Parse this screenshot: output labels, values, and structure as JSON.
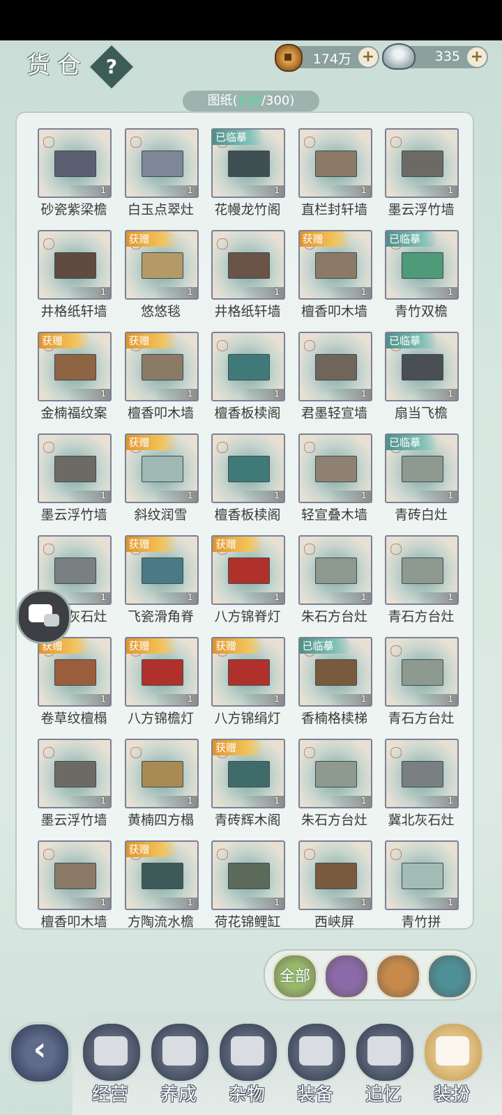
{
  "header": {
    "title": "货仓",
    "help_label": "?",
    "copper": {
      "value": "174万",
      "plus": "+"
    },
    "silver": {
      "value": "335",
      "plus": "+"
    }
  },
  "blueprint_tab": {
    "label": "图纸",
    "count": "120",
    "total": "300"
  },
  "items": [
    {
      "name": "砂瓷紫梁檐",
      "qty": "1",
      "badge": "",
      "color": "#5b5e70"
    },
    {
      "name": "白玉点翠灶",
      "qty": "1",
      "badge": "",
      "color": "#7e8797"
    },
    {
      "name": "花幔龙竹阁",
      "qty": "1",
      "badge": "已临摹",
      "color": "#3f4f52"
    },
    {
      "name": "直栏封轩墙",
      "qty": "1",
      "badge": "",
      "color": "#8a7a66"
    },
    {
      "name": "墨云浮竹墙",
      "qty": "1",
      "badge": "",
      "color": "#6d6a66"
    },
    {
      "name": "井格纸轩墙",
      "qty": "1",
      "badge": "",
      "color": "#5f4b3f"
    },
    {
      "name": "悠悠毯",
      "qty": "1",
      "badge": "获赠",
      "color": "#b49a66"
    },
    {
      "name": "井格纸轩墙",
      "qty": "1",
      "badge": "",
      "color": "#6a5447"
    },
    {
      "name": "檀香叩木墙",
      "qty": "1",
      "badge": "获赠",
      "color": "#8a7a66"
    },
    {
      "name": "青竹双檐",
      "qty": "1",
      "badge": "已临摹",
      "color": "#4f9a78"
    },
    {
      "name": "金楠福纹案",
      "qty": "1",
      "badge": "获赠",
      "color": "#8e6443"
    },
    {
      "name": "檀香叩木墙",
      "qty": "1",
      "badge": "获赠",
      "color": "#8a7a66"
    },
    {
      "name": "檀香板椟阁",
      "qty": "1",
      "badge": "",
      "color": "#3f7a78"
    },
    {
      "name": "君墨轻宣墙",
      "qty": "1",
      "badge": "",
      "color": "#6f655a"
    },
    {
      "name": "扇当飞檐",
      "qty": "1",
      "badge": "已临摹",
      "color": "#4a4e55"
    },
    {
      "name": "墨云浮竹墙",
      "qty": "1",
      "badge": "",
      "color": "#6d6a66"
    },
    {
      "name": "斜纹润雪",
      "qty": "1",
      "badge": "获赠",
      "color": "#9fb8b4"
    },
    {
      "name": "檀香板椟阁",
      "qty": "1",
      "badge": "",
      "color": "#3f7a78"
    },
    {
      "name": "轻宣叠木墙",
      "qty": "1",
      "badge": "",
      "color": "#8f8172"
    },
    {
      "name": "青砖白灶",
      "qty": "1",
      "badge": "已临摹",
      "color": "#8e9a8f"
    },
    {
      "name": "冀北灰石灶",
      "qty": "1",
      "badge": "",
      "color": "#7a7f82"
    },
    {
      "name": "飞瓷滑角脊",
      "qty": "1",
      "badge": "获赠",
      "color": "#4a7a86"
    },
    {
      "name": "八方锦脊灯",
      "qty": "1",
      "badge": "获赠",
      "color": "#b0312c"
    },
    {
      "name": "朱石方台灶",
      "qty": "1",
      "badge": "",
      "color": "#8e9a8f"
    },
    {
      "name": "青石方台灶",
      "qty": "1",
      "badge": "",
      "color": "#8e9a8f"
    },
    {
      "name": "卷草纹檀榻",
      "qty": "1",
      "badge": "获赠",
      "color": "#9a5e3c"
    },
    {
      "name": "八方锦檐灯",
      "qty": "1",
      "badge": "获赠",
      "color": "#b0312c"
    },
    {
      "name": "八方锦绢灯",
      "qty": "1",
      "badge": "获赠",
      "color": "#b0312c"
    },
    {
      "name": "香楠格椟梯",
      "qty": "1",
      "badge": "已临摹",
      "color": "#7a5a3e"
    },
    {
      "name": "青石方台灶",
      "qty": "1",
      "badge": "",
      "color": "#8e9a8f"
    },
    {
      "name": "墨云浮竹墙",
      "qty": "1",
      "badge": "",
      "color": "#6d6a66"
    },
    {
      "name": "黄楠四方榻",
      "qty": "1",
      "badge": "",
      "color": "#a88a52"
    },
    {
      "name": "青砖辉木阁",
      "qty": "1",
      "badge": "获赠",
      "color": "#3f6c6a"
    },
    {
      "name": "朱石方台灶",
      "qty": "1",
      "badge": "",
      "color": "#8e9a8f"
    },
    {
      "name": "冀北灰石灶",
      "qty": "1",
      "badge": "",
      "color": "#7a7f82"
    },
    {
      "name": "檀香叩木墙",
      "qty": "1",
      "badge": "",
      "color": "#8a7a66"
    },
    {
      "name": "方陶流水檐",
      "qty": "1",
      "badge": "获赠",
      "color": "#3d5a58"
    },
    {
      "name": "荷花锦鲤缸",
      "qty": "1",
      "badge": "",
      "color": "#5c6a5a"
    },
    {
      "name": "西峡屏",
      "qty": "1",
      "badge": "",
      "color": "#7a5a3e"
    },
    {
      "name": "青竹拼",
      "qty": "1",
      "badge": "",
      "color": "#a3bdb6"
    }
  ],
  "filters": [
    {
      "label": "全部",
      "name": "filter-all-button",
      "color": "#9ab86a"
    },
    {
      "label": "",
      "name": "filter-blueprint-button",
      "color": "#8a6aa8"
    },
    {
      "label": "",
      "name": "filter-material-button",
      "color": "#c88a4a"
    },
    {
      "label": "",
      "name": "filter-furniture-button",
      "color": "#4f8f96"
    }
  ],
  "nav": [
    {
      "label": "经营",
      "icon": "bowl-icon",
      "active": false
    },
    {
      "label": "养成",
      "icon": "crystal-icon",
      "active": false
    },
    {
      "label": "杂物",
      "icon": "bundle-icon",
      "active": false
    },
    {
      "label": "装备",
      "icon": "robe-icon",
      "active": false
    },
    {
      "label": "追忆",
      "icon": "letter-icon",
      "active": false
    },
    {
      "label": "装扮",
      "icon": "pavilion-icon",
      "active": true
    }
  ],
  "colors": {
    "gift_badge": "#e0942c",
    "copied_badge": "#4f8f8a",
    "count_highlight": "#4fe0a0"
  }
}
